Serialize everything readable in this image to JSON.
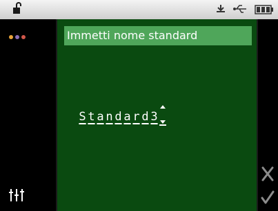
{
  "statusbar": {
    "icons": [
      "lock-open-icon",
      "sync-icon",
      "usb-icon",
      "battery-icon"
    ]
  },
  "left_rail": {
    "icons": [
      "dots-menu-icon",
      "sliders-icon"
    ],
    "dot_colors": [
      "#e8a33a",
      "#8a6fb6",
      "#d0574a"
    ]
  },
  "dialog": {
    "title": "Immetti nome standard",
    "name_chars": [
      "S",
      "t",
      "a",
      "n",
      "d",
      "a",
      "r",
      "d",
      "3"
    ]
  },
  "right_rail": {
    "icons": [
      "cancel-icon",
      "confirm-icon"
    ]
  },
  "colors": {
    "panel_bg": "#0a4a10",
    "title_bg": "#4fa65a",
    "icon_gray": "#8c8c8c"
  }
}
